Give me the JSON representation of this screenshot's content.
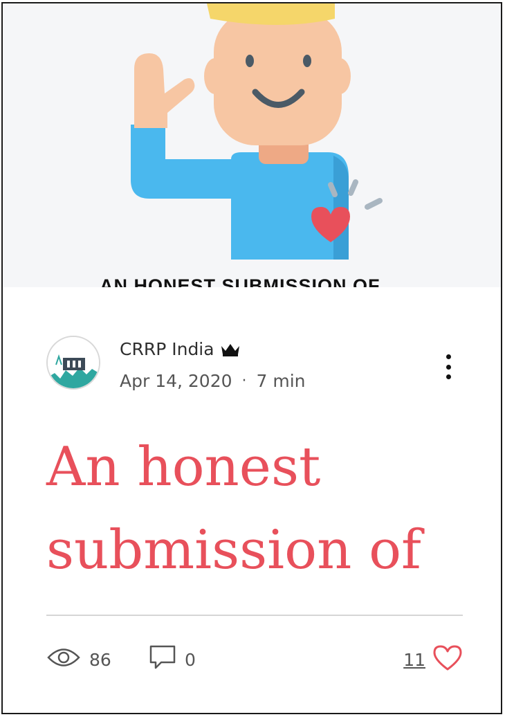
{
  "post": {
    "cover_caption": "AN HONEST SUBMISSION OF",
    "author": "CRRP India",
    "date": "Apr 14, 2020",
    "separator": "·",
    "read_time": "7 min",
    "title": "An honest submission of",
    "views": "86",
    "comments": "0",
    "likes": "11"
  },
  "icons": {
    "author_badge": "crown-icon",
    "menu": "more-options-icon",
    "views": "eye-icon",
    "comments": "comment-icon",
    "likes": "heart-icon"
  },
  "colors": {
    "title": "#e8505b",
    "heart": "#e8505b",
    "shirt": "#4ab8ee",
    "hair": "#f5d66a",
    "skin": "#f7c6a3"
  }
}
